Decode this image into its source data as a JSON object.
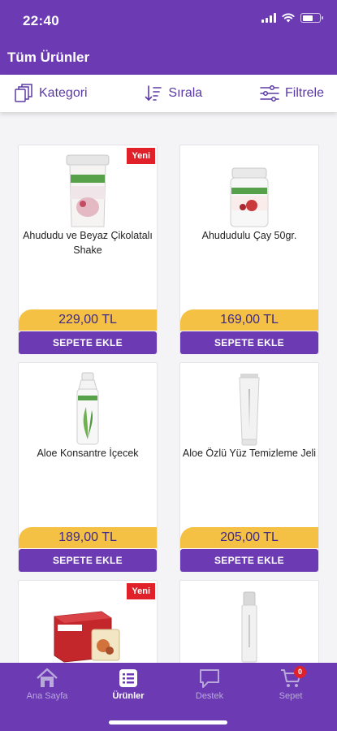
{
  "status_bar": {
    "time": "22:40"
  },
  "header": {
    "title": "Tüm Ürünler"
  },
  "toolbar": {
    "category_label": "Kategori",
    "sort_label": "Sırala",
    "filter_label": "Filtrele"
  },
  "products": [
    {
      "name": "Ahududu ve Beyaz Çikolatalı Shake",
      "price": "229,00 TL",
      "button": "SEPETE EKLE",
      "badge": "Yeni"
    },
    {
      "name": "Ahududulu Çay 50gr.",
      "price": "169,00 TL",
      "button": "SEPETE EKLE"
    },
    {
      "name": "Aloe Konsantre İçecek",
      "price": "189,00 TL",
      "button": "SEPETE EKLE"
    },
    {
      "name": "Aloe Özlü Yüz Temizleme Jeli",
      "price": "205,00 TL",
      "button": "SEPETE EKLE"
    },
    {
      "badge": "Yeni"
    },
    {}
  ],
  "tabbar": {
    "home": "Ana Sayfa",
    "products": "Ürünler",
    "support": "Destek",
    "cart": "Sepet",
    "cart_count": "0"
  },
  "colors": {
    "brand": "#6c3bb4",
    "price_bg": "#f5c145",
    "badge": "#e0212a"
  }
}
